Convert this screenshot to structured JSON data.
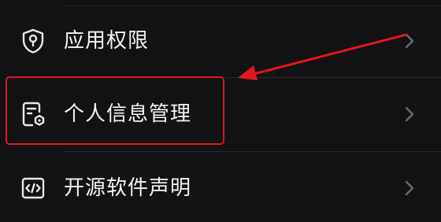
{
  "settings_list": {
    "items": [
      {
        "label": "应用权限",
        "icon": "shield-person-icon",
        "chevron": "chevron-right-icon"
      },
      {
        "label": "个人信息管理",
        "icon": "document-settings-icon",
        "chevron": "chevron-right-icon"
      },
      {
        "label": "开源软件声明",
        "icon": "code-window-icon",
        "chevron": "chevron-right-icon"
      }
    ]
  },
  "annotation": {
    "color": "#e3161d",
    "target": "个人信息管理"
  },
  "colors": {
    "background": "#131316",
    "divider": "#2a2a2e",
    "text": "#f4f4f5",
    "chevron": "#6b6b70",
    "annotation": "#e3161d"
  }
}
